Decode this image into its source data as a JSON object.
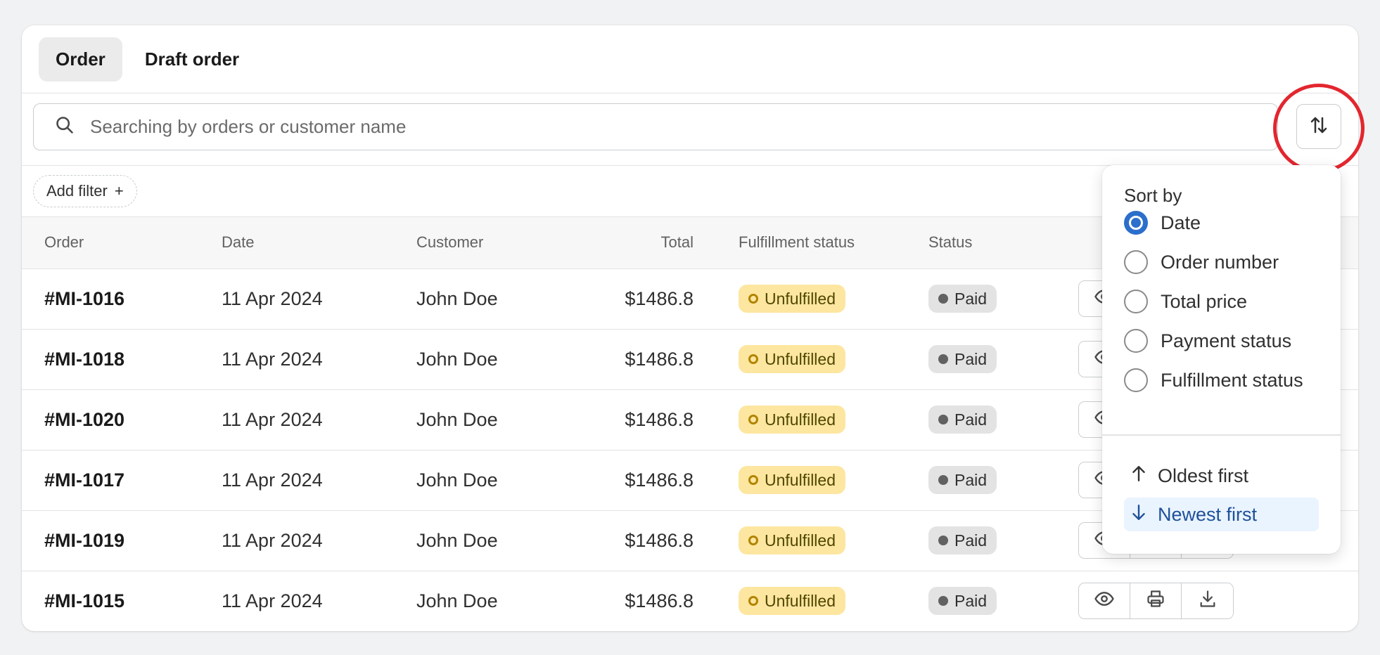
{
  "tabs": [
    {
      "label": "Order",
      "active": true
    },
    {
      "label": "Draft order",
      "active": false
    }
  ],
  "search": {
    "placeholder": "Searching by orders or customer name",
    "value": ""
  },
  "filter": {
    "add_filter_label": "Add filter",
    "plus": "+"
  },
  "table": {
    "headers": {
      "order": "Order",
      "date": "Date",
      "customer": "Customer",
      "total": "Total",
      "fulfillment": "Fulfillment status",
      "status": "Status"
    },
    "rows": [
      {
        "order": "#MI-1016",
        "date": "11 Apr 2024",
        "customer": "John Doe",
        "total": "$1486.8",
        "fulfillment": "Unfulfilled",
        "status": "Paid"
      },
      {
        "order": "#MI-1018",
        "date": "11 Apr 2024",
        "customer": "John Doe",
        "total": "$1486.8",
        "fulfillment": "Unfulfilled",
        "status": "Paid"
      },
      {
        "order": "#MI-1020",
        "date": "11 Apr 2024",
        "customer": "John Doe",
        "total": "$1486.8",
        "fulfillment": "Unfulfilled",
        "status": "Paid"
      },
      {
        "order": "#MI-1017",
        "date": "11 Apr 2024",
        "customer": "John Doe",
        "total": "$1486.8",
        "fulfillment": "Unfulfilled",
        "status": "Paid"
      },
      {
        "order": "#MI-1019",
        "date": "11 Apr 2024",
        "customer": "John Doe",
        "total": "$1486.8",
        "fulfillment": "Unfulfilled",
        "status": "Paid"
      },
      {
        "order": "#MI-1015",
        "date": "11 Apr 2024",
        "customer": "John Doe",
        "total": "$1486.8",
        "fulfillment": "Unfulfilled",
        "status": "Paid"
      }
    ],
    "row_actions": [
      "view-icon",
      "print-icon",
      "download-icon"
    ]
  },
  "sort_popover": {
    "title": "Sort by",
    "options": [
      {
        "label": "Date",
        "selected": true
      },
      {
        "label": "Order number",
        "selected": false
      },
      {
        "label": "Total price",
        "selected": false
      },
      {
        "label": "Payment status",
        "selected": false
      },
      {
        "label": "Fulfillment status",
        "selected": false
      }
    ],
    "directions": [
      {
        "label": "Oldest first",
        "icon": "arrow-up-icon",
        "selected": false
      },
      {
        "label": "Newest first",
        "icon": "arrow-down-icon",
        "selected": true
      }
    ]
  },
  "colors": {
    "accent": "#2c6ecb",
    "annotation": "#e3262e",
    "unfulfilled_badge": "#fde6a0",
    "paid_badge": "#e3e3e3"
  }
}
